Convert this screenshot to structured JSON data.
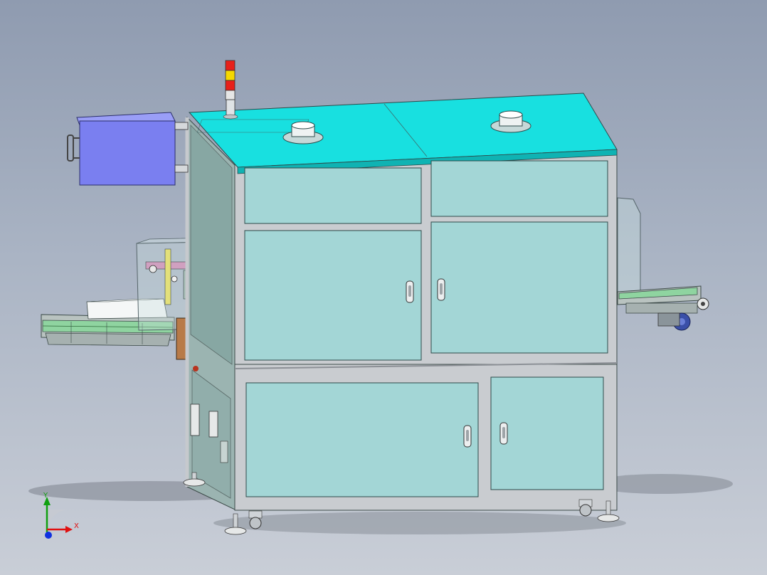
{
  "axis_triad": {
    "x_label": "X",
    "y_label": "Y"
  },
  "colors": {
    "background_top": "#8f9bb0",
    "background_bottom": "#c9ced7",
    "top_panel": "#18e0e0",
    "panel_fill": "#a3d6d6",
    "frame": "#c9ccd0",
    "control_box": "#7a7ff0",
    "conveyor_belt": "#4fc06a",
    "signal_red": "#e8201a",
    "signal_yellow": "#f5d800",
    "motor_blue": "#3a4fa8",
    "axis_x": "#e01010",
    "axis_y": "#10a010",
    "axis_z": "#1030e0"
  }
}
